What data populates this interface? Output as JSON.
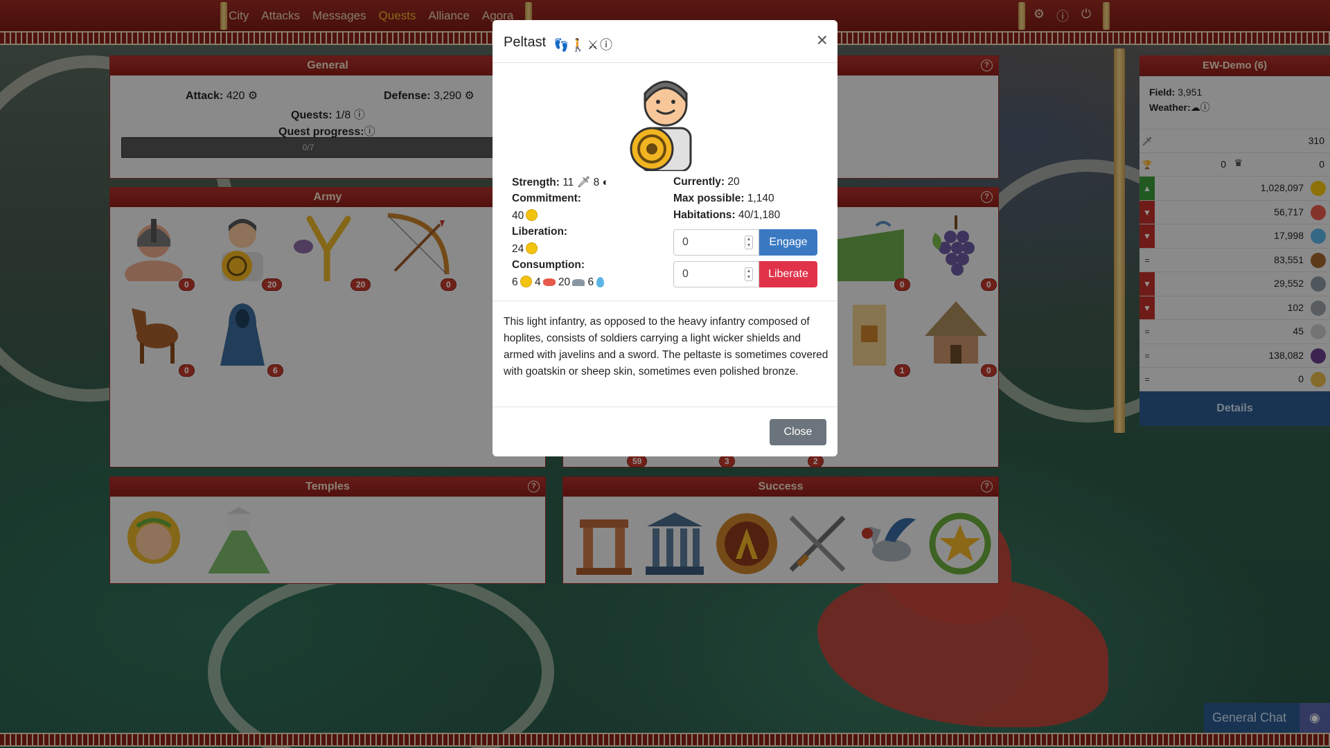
{
  "nav": {
    "items": [
      "City",
      "Attacks",
      "Messages",
      "Quests",
      "Alliance",
      "Agora"
    ],
    "active": "Quests"
  },
  "general": {
    "title": "General",
    "attack_label": "Attack:",
    "attack_value": "420",
    "defense_label": "Defense:",
    "defense_value": "3,290",
    "quests_label": "Quests:",
    "quests_value": "1/8",
    "quest_progress_label": "Quest progress:",
    "progress_text": "0/7"
  },
  "army": {
    "title": "Army",
    "units": [
      {
        "name": "hoplite",
        "count": "0"
      },
      {
        "name": "peltast",
        "count": "20"
      },
      {
        "name": "slinger",
        "count": "20"
      },
      {
        "name": "archer",
        "count": "0"
      },
      {
        "name": "horseman",
        "count": "0"
      },
      {
        "name": "spy",
        "count": "6"
      }
    ]
  },
  "buildings": {
    "counts": [
      "0",
      "0",
      "1",
      "0"
    ],
    "hidden_counts": [
      "59",
      "3",
      "2"
    ]
  },
  "temples": {
    "title": "Temples"
  },
  "success": {
    "title": "Success"
  },
  "sidebar": {
    "title": "EW-Demo (6)",
    "field_label": "Field:",
    "field_value": "3,951",
    "weather_label": "Weather:",
    "attack_value": "310",
    "trophy_value": "0",
    "crown_value": "0",
    "resources": [
      {
        "name": "gold",
        "trend": "up",
        "value": "1,028,097",
        "color": "#f2c40f"
      },
      {
        "name": "meat",
        "trend": "down",
        "value": "56,717",
        "color": "#e55a4a"
      },
      {
        "name": "water",
        "trend": "down",
        "value": "17,998",
        "color": "#5bb4e5"
      },
      {
        "name": "wood",
        "trend": "equal",
        "value": "83,551",
        "color": "#a0652a"
      },
      {
        "name": "stone",
        "trend": "down",
        "value": "29,552",
        "color": "#8a96a0"
      },
      {
        "name": "iron",
        "trend": "down",
        "value": "102",
        "color": "#9aa0a6"
      },
      {
        "name": "marble",
        "trend": "equal",
        "value": "45",
        "color": "#c9c9c9"
      },
      {
        "name": "grapes",
        "trend": "equal",
        "value": "138,082",
        "color": "#6a3d8a"
      },
      {
        "name": "population",
        "trend": "equal",
        "value": "0",
        "color": "#e5b84a"
      }
    ],
    "details_label": "Details"
  },
  "chat": {
    "label": "General Chat"
  },
  "modal": {
    "title": "Peltast",
    "strength_label": "Strength:",
    "strength_attack": "11",
    "strength_defense": "8",
    "commitment_label": "Commitment:",
    "commitment_value": "40",
    "liberation_label": "Liberation:",
    "liberation_value": "24",
    "consumption_label": "Consumption:",
    "consumption_gold": "6",
    "consumption_meat": "4",
    "consumption_stone": "20",
    "consumption_water": "6",
    "currently_label": "Currently:",
    "currently_value": "20",
    "max_label": "Max possible:",
    "max_value": "1,140",
    "habitations_label": "Habitations:",
    "habitations_value": "40/1,180",
    "engage_value": "0",
    "liberate_value": "0",
    "engage_label": "Engage",
    "liberate_label": "Liberate",
    "description": "This light infantry, as opposed to the heavy infantry composed of hoplites, consists of soldiers carrying a light wicker shields and armed with javelins and a sword. The peltaste is sometimes covered with goatskin or sheep skin, sometimes even polished bronze.",
    "close_label": "Close"
  }
}
